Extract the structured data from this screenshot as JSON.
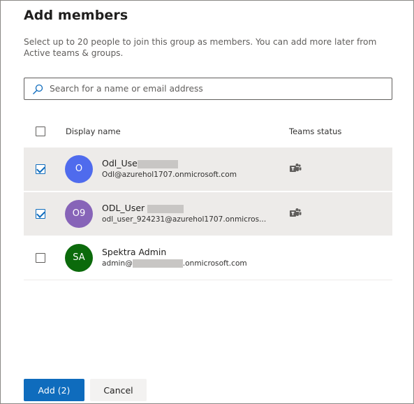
{
  "dialog": {
    "title": "Add members",
    "description": "Select up to 20 people to join this group as members. You can add more later from Active teams & groups."
  },
  "search": {
    "placeholder": "Search for a name or email address",
    "value": ""
  },
  "table": {
    "header_display_name": "Display name",
    "header_teams_status": "Teams status",
    "rows": [
      {
        "initials": "O",
        "name": "Odl_Use",
        "email": "Odl@azurehol1707.onmicrosoft.com",
        "checked": true,
        "avatar_color": "#4f6bed"
      },
      {
        "initials": "O9",
        "name": "ODL_User",
        "email": "odl_user_924231@azurehol1707.onmicros...",
        "checked": true,
        "avatar_color": "#8764b8"
      },
      {
        "initials": "SA",
        "name": "Spektra Admin",
        "email_prefix": "admin@",
        "email_suffix": ".onmicrosoft.com",
        "checked": false,
        "avatar_color": "#0b6a0b"
      }
    ]
  },
  "footer": {
    "add_label": "Add (2)",
    "cancel_label": "Cancel"
  },
  "colors": {
    "primary": "#0f6cbd",
    "selected_row": "#edebe9"
  }
}
